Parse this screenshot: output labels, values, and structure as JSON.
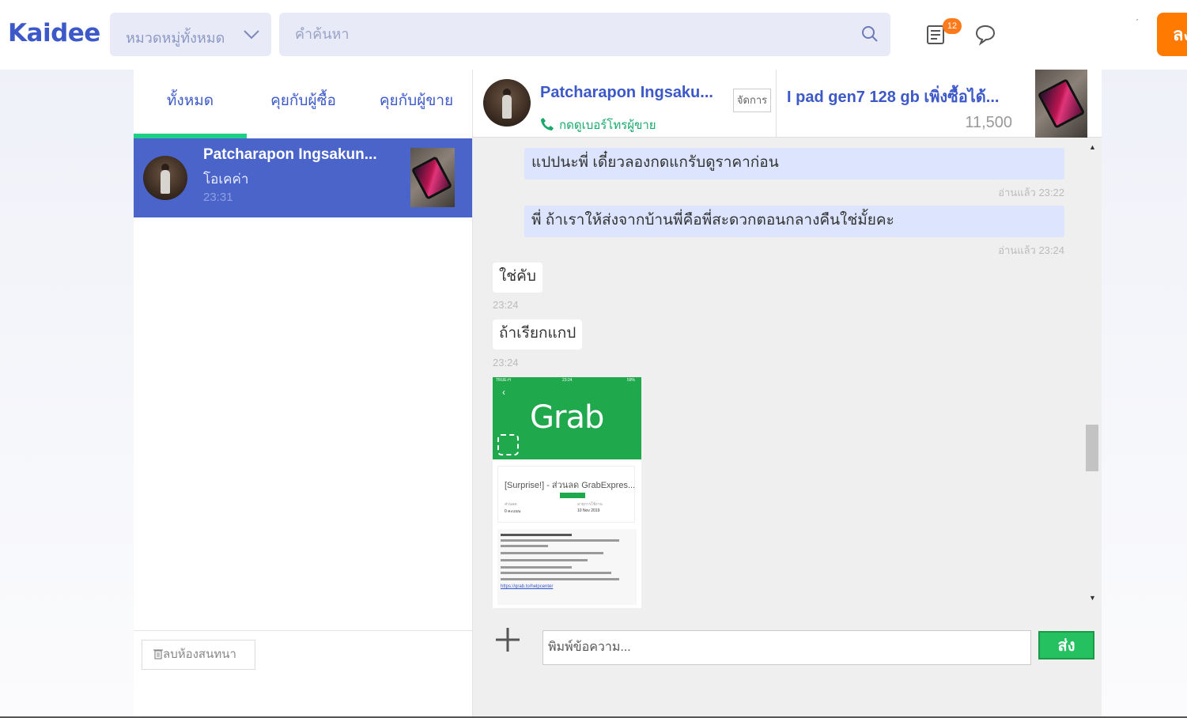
{
  "header": {
    "logo": "Kaidee",
    "category_select": "หมวดหมู่ทั้งหมด",
    "search_placeholder": "คำค้นหา",
    "news_badge": "12",
    "tick_mark": "ˊ",
    "sell_button": "ลง"
  },
  "sidebar": {
    "tabs": [
      {
        "label": "ทั้งหมด"
      },
      {
        "label": "คุยกับผู้ซื้อ"
      },
      {
        "label": "คุยกับผู้ขาย"
      }
    ],
    "conversations": [
      {
        "name": "Patcharapon Ingsakun...",
        "last_message": "โอเคค่า",
        "time": "23:31"
      }
    ],
    "delete_button": "ลบห้องสนทนา"
  },
  "chat": {
    "contact_name": "Patcharapon Ingsaku...",
    "phone_link": "กดดูเบอร์โทรผู้ขาย",
    "manage_button": "จัดการ",
    "listing_title": "I pad gen7 128 gb เพิ่งซื้อได้...",
    "listing_price": "11,500",
    "messages": [
      {
        "text": "แปปนะพี่ เดี๋ยวลองกดแกรับดูราคาก่อน",
        "meta": "อ่านแล้ว 23:22"
      },
      {
        "text": "พี่ ถ้าเราให้ส่งจากบ้านพี่คือพี่สะดวกตอนกลางคืนใช่มั้ยคะ",
        "meta": "อ่านแล้ว 23:24"
      },
      {
        "text": "ใช่คับ",
        "meta": "23:24"
      },
      {
        "text": "ถ้าเรียกแกป",
        "meta": "23:24"
      }
    ],
    "image_message": {
      "status_left": "TRUE-H",
      "status_time": "23:24",
      "status_right": "59%",
      "brand": "Grab",
      "card_title": "[Surprise!] - ส่วนลด GrabExpres...",
      "card_left_label": "ส่วนลด",
      "card_left_value": "0 คะแนน",
      "card_right_label": "อายุการใช้งาน",
      "card_right_value": "10 Nov 2019",
      "link": "https://grab.to/helpcenter"
    },
    "composer": {
      "placeholder": "พิมพ์ข้อความ...",
      "send_label": "ส่ง"
    }
  },
  "colors": {
    "brand_blue": "#3d59c9",
    "selected_conversation": "#4a64c9",
    "active_tab_underline": "#1ed087",
    "outgoing_bubble": "#dce5fd",
    "send_button": "#25c05f",
    "sell_button": "#ff7a00",
    "badge": "#ff7a1a"
  },
  "icons": {
    "category_chevron": "chevron-down-icon",
    "search": "search-icon",
    "news": "newspaper-icon",
    "chat": "chat-bubble-icon",
    "phone": "phone-icon",
    "trash": "trash-icon",
    "plus": "plus-icon"
  }
}
